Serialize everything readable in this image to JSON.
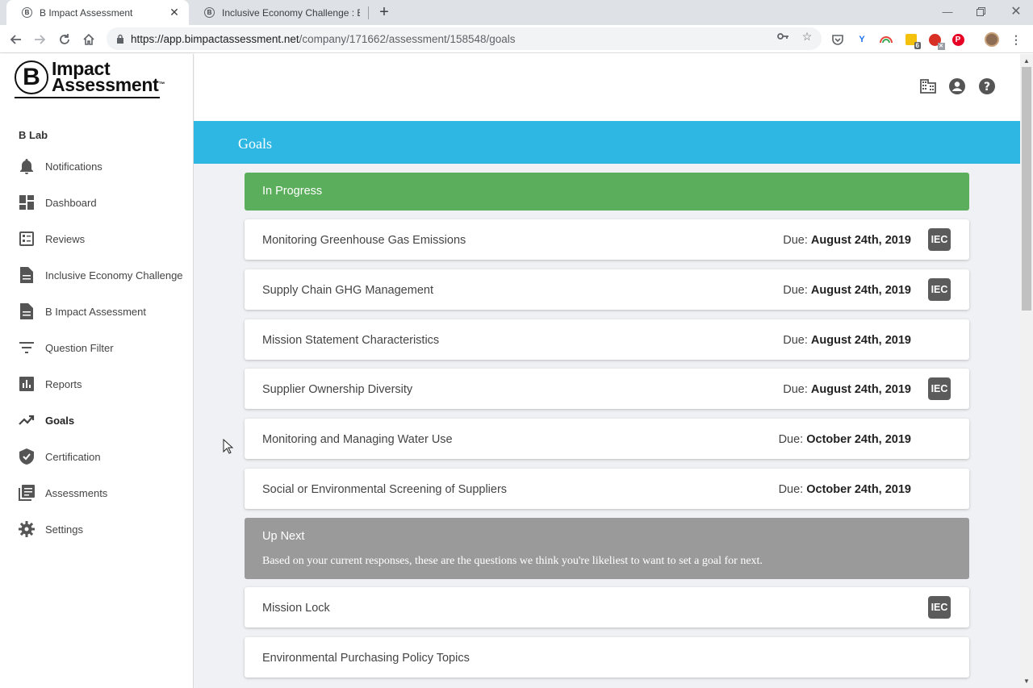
{
  "browser": {
    "tabs": [
      {
        "title": "B Impact Assessment",
        "favicon": "B",
        "active": true
      },
      {
        "title": "Inclusive Economy Challenge : B",
        "favicon": "B",
        "active": false
      }
    ],
    "url_host": "https://app.bimpactassessment.net",
    "url_path": "/company/171662/assessment/158548/goals",
    "extension_badge": "6"
  },
  "logo": {
    "letter": "B",
    "line1": "Impact",
    "line2": "Assessment",
    "tm": "™"
  },
  "sidebar": {
    "org_name": "B Lab",
    "items": [
      {
        "label": "Notifications",
        "icon": "bell-icon"
      },
      {
        "label": "Dashboard",
        "icon": "dashboard-icon"
      },
      {
        "label": "Reviews",
        "icon": "reviews-icon"
      },
      {
        "label": "Inclusive Economy Challenge",
        "icon": "document-icon"
      },
      {
        "label": "B Impact Assessment",
        "icon": "document-icon"
      },
      {
        "label": "Question Filter",
        "icon": "filter-icon"
      },
      {
        "label": "Reports",
        "icon": "bar-chart-icon"
      },
      {
        "label": "Goals",
        "icon": "trending-up-icon",
        "active": true
      },
      {
        "label": "Certification",
        "icon": "shield-check-icon"
      },
      {
        "label": "Assessments",
        "icon": "library-icon"
      },
      {
        "label": "Settings",
        "icon": "gear-icon"
      }
    ]
  },
  "page": {
    "title": "Goals",
    "in_progress": {
      "title": "In Progress",
      "due_prefix": "Due:",
      "goals": [
        {
          "title": "Monitoring Greenhouse Gas Emissions",
          "due": "August 24th, 2019",
          "badge": "IEC"
        },
        {
          "title": "Supply Chain GHG Management",
          "due": "August 24th, 2019",
          "badge": "IEC"
        },
        {
          "title": "Mission Statement Characteristics",
          "due": "August 24th, 2019",
          "badge": ""
        },
        {
          "title": "Supplier Ownership Diversity",
          "due": "August 24th, 2019",
          "badge": "IEC"
        },
        {
          "title": "Monitoring and Managing Water Use",
          "due": "October 24th, 2019",
          "badge": ""
        },
        {
          "title": "Social or Environmental Screening of Suppliers",
          "due": "October 24th, 2019",
          "badge": ""
        }
      ]
    },
    "up_next": {
      "title": "Up Next",
      "description": "Based on your current responses, these are the questions we think you're likeliest to want to set a goal for next.",
      "goals": [
        {
          "title": "Mission Lock",
          "badge": "IEC"
        },
        {
          "title": "Environmental Purchasing Policy Topics",
          "badge": ""
        }
      ]
    }
  },
  "colors": {
    "banner": "#2fb7e4",
    "in_progress": "#5bae5b",
    "up_next": "#9a9a9a",
    "badge": "#5b5b5b"
  }
}
